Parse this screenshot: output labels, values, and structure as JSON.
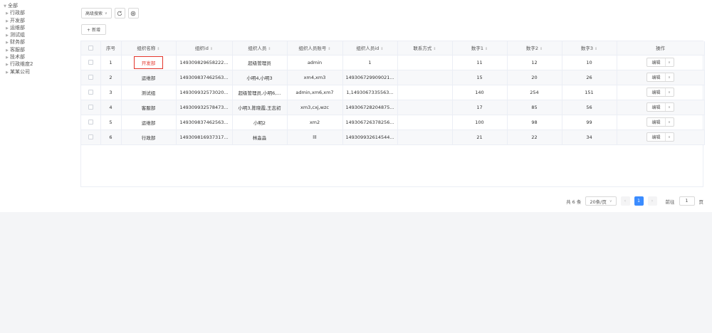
{
  "tree": {
    "root": "全部",
    "children": [
      "行政部",
      "开发部",
      "运维部",
      "测试组",
      "财务部",
      "客服部",
      "技术部",
      "行政维度2",
      "某某公司"
    ]
  },
  "toolbar": {
    "search_label": "高级搜索",
    "add_label": "+ 新增"
  },
  "table": {
    "columns": [
      "序号",
      "组织名称",
      "组织id",
      "组织人员",
      "组织人员账号",
      "组织人员id",
      "联系方式",
      "数字1",
      "数字2",
      "数字3",
      "操作"
    ],
    "sortable": [
      false,
      true,
      true,
      true,
      true,
      true,
      true,
      true,
      true,
      true,
      false
    ],
    "rows": [
      {
        "idx": "1",
        "name": "开发部",
        "org_id": "149309829658222...",
        "members": "超级管理员",
        "accounts": "admin",
        "member_ids": "1",
        "contact": "",
        "n1": "11",
        "n2": "12",
        "n3": "10"
      },
      {
        "idx": "2",
        "name": "运维部",
        "org_id": "149309837462563...",
        "members": "小明4,小明3",
        "accounts": "xm4,xm3",
        "member_ids": "149306729909021...",
        "contact": "",
        "n1": "15",
        "n2": "20",
        "n3": "26"
      },
      {
        "idx": "3",
        "name": "测试组",
        "org_id": "149309932573020...",
        "members": "超级管理员,小明6,...",
        "accounts": "admin,xm6,xm7",
        "member_ids": "1,1493067335563...",
        "contact": "",
        "n1": "140",
        "n2": "254",
        "n3": "151"
      },
      {
        "idx": "4",
        "name": "客服部",
        "org_id": "149309932578473...",
        "members": "小明3,陈晓霞,王志初",
        "accounts": "xm3,cxj,wzc",
        "member_ids": "149306728204875...",
        "contact": "",
        "n1": "17",
        "n2": "85",
        "n3": "56"
      },
      {
        "idx": "5",
        "name": "运维部",
        "org_id": "149309837462563...",
        "members": "小明2",
        "accounts": "xm2",
        "member_ids": "149306726378256...",
        "contact": "",
        "n1": "100",
        "n2": "98",
        "n3": "99"
      },
      {
        "idx": "6",
        "name": "行政部",
        "org_id": "149309816937317...",
        "members": "林淼淼",
        "accounts": "lll",
        "member_ids": "149309932614544...",
        "contact": "",
        "n1": "21",
        "n2": "22",
        "n3": "34"
      }
    ],
    "edit_label": "编辑"
  },
  "pagination": {
    "total_text": "共 6 条",
    "page_size": "20条/页",
    "current_page": "1",
    "goto_label": "前往",
    "goto_value": "1",
    "page_suffix": "页"
  },
  "colors": {
    "highlight": "#e3352b",
    "accent": "#3b8cff"
  }
}
